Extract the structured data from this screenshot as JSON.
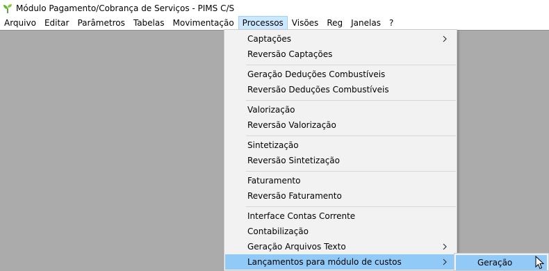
{
  "window": {
    "title": "Módulo Pagamento/Cobrança de Serviços - PIMS C/S",
    "icon": "sprout-icon"
  },
  "menubar": {
    "items": [
      "Arquivo",
      "Editar",
      "Parâmetros",
      "Tabelas",
      "Movimentação",
      "Processos",
      "Visões",
      "Reg",
      "Janelas",
      "?"
    ],
    "active": "Processos"
  },
  "processos_menu": {
    "items": [
      {
        "label": "Captações",
        "submenu": true
      },
      {
        "label": "Reversão Captações"
      },
      {
        "label": "Geração Deduções Combustíveis"
      },
      {
        "label": "Reversão Deduções Combustíveis"
      },
      {
        "label": "Valorização"
      },
      {
        "label": "Reversão Valorização"
      },
      {
        "label": "Sintetização"
      },
      {
        "label": "Reversão Sintetização"
      },
      {
        "label": "Faturamento"
      },
      {
        "label": "Reversão Faturamento"
      },
      {
        "label": "Interface Contas Corrente"
      },
      {
        "label": "Contabilização"
      },
      {
        "label": "Geração Arquivos Texto",
        "submenu": true
      },
      {
        "label": "Lançamentos para módulo de custos",
        "submenu": true,
        "highlighted": true
      }
    ]
  },
  "submenu": {
    "items": [
      "Geração"
    ]
  },
  "colors": {
    "highlight": "#91c9f7",
    "menu_active": "#cce8ff",
    "workspace": "#ababab",
    "menu_bg": "#f2f2f2"
  }
}
